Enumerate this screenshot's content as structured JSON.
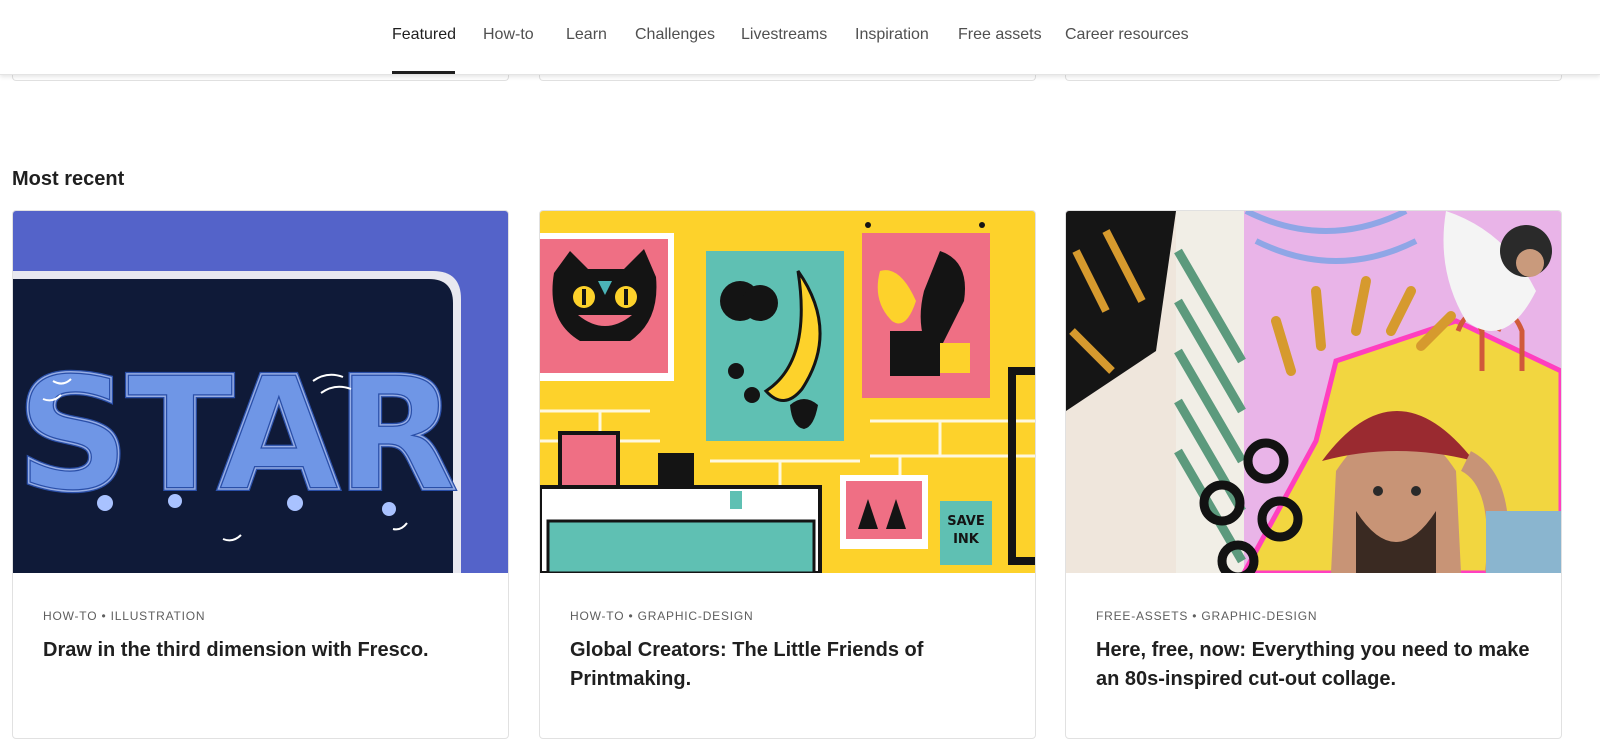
{
  "nav": {
    "tabs": [
      {
        "label": "Featured",
        "active": true
      },
      {
        "label": "How-to"
      },
      {
        "label": "Learn"
      },
      {
        "label": "Challenges"
      },
      {
        "label": "Livestreams"
      },
      {
        "label": "Inspiration"
      },
      {
        "label": "Free assets"
      },
      {
        "label": "Career resources"
      }
    ]
  },
  "section": {
    "title": "Most recent"
  },
  "cards": [
    {
      "category": "HOW-TO • ILLUSTRATION",
      "title": "Draw in the third dimension with Fresco.",
      "image": "star-lettering-illustration",
      "text_in_image": "STAR"
    },
    {
      "category": "HOW-TO • GRAPHIC-DESIGN",
      "title": "Global Creators: The Little Friends of Printmaking.",
      "image": "cat-fruit-plant-poster-wall",
      "text_in_image": "SAVE INK"
    },
    {
      "category": "FREE-ASSETS • GRAPHIC-DESIGN",
      "title": "Here, free, now: Everything you need to make an 80s-inspired cut-out collage.",
      "image": "man-red-beanie-collage"
    }
  ],
  "colors": {
    "accent": "#1f1f1f",
    "border": "#e1e1e1",
    "star_bg": "#5463c9",
    "poster_yellow": "#fdd22b"
  }
}
